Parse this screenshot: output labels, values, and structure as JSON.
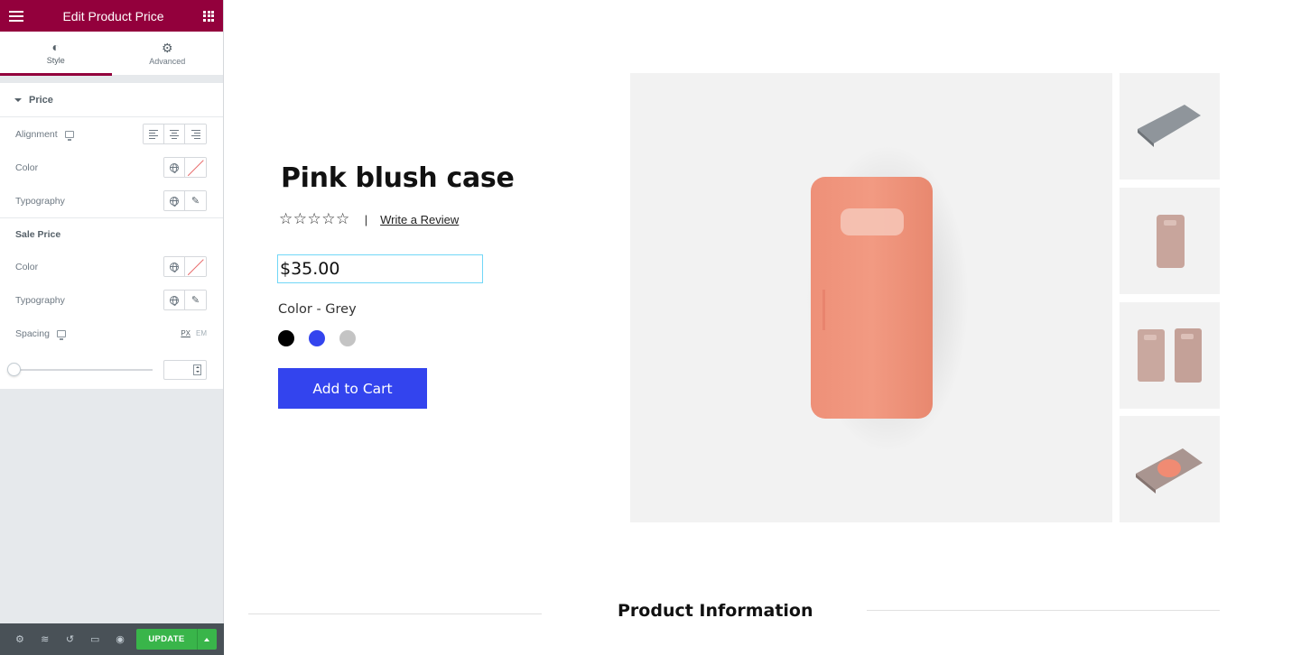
{
  "sidebar": {
    "title": "Edit Product Price",
    "tabs": [
      {
        "label": "Style",
        "icon": "contrast-icon"
      },
      {
        "label": "Advanced",
        "icon": "gear-icon"
      }
    ],
    "price_section": {
      "heading": "Price",
      "alignment_label": "Alignment",
      "color_label": "Color",
      "typography_label": "Typography"
    },
    "sale_section": {
      "heading": "Sale Price",
      "color_label": "Color",
      "typography_label": "Typography",
      "spacing_label": "Spacing",
      "unit_px": "PX",
      "unit_em": "EM",
      "spacing_value": ""
    },
    "footer": {
      "update_label": "UPDATE"
    },
    "colors": {
      "header_bg": "#93003c",
      "update_bg": "#39b54a",
      "footer_bg": "#495157"
    }
  },
  "product": {
    "title": "Pink blush case",
    "stars": "☆☆☆☆☆",
    "separator": "|",
    "review_link": "Write a Review",
    "price": "$35.00",
    "color_label": "Color - Grey",
    "swatches": [
      "#000000",
      "#3344ee",
      "#c4c4c4"
    ],
    "add_to_cart": "Add to Cart",
    "section_title": "Product Information",
    "button_color": "#3344ee"
  }
}
